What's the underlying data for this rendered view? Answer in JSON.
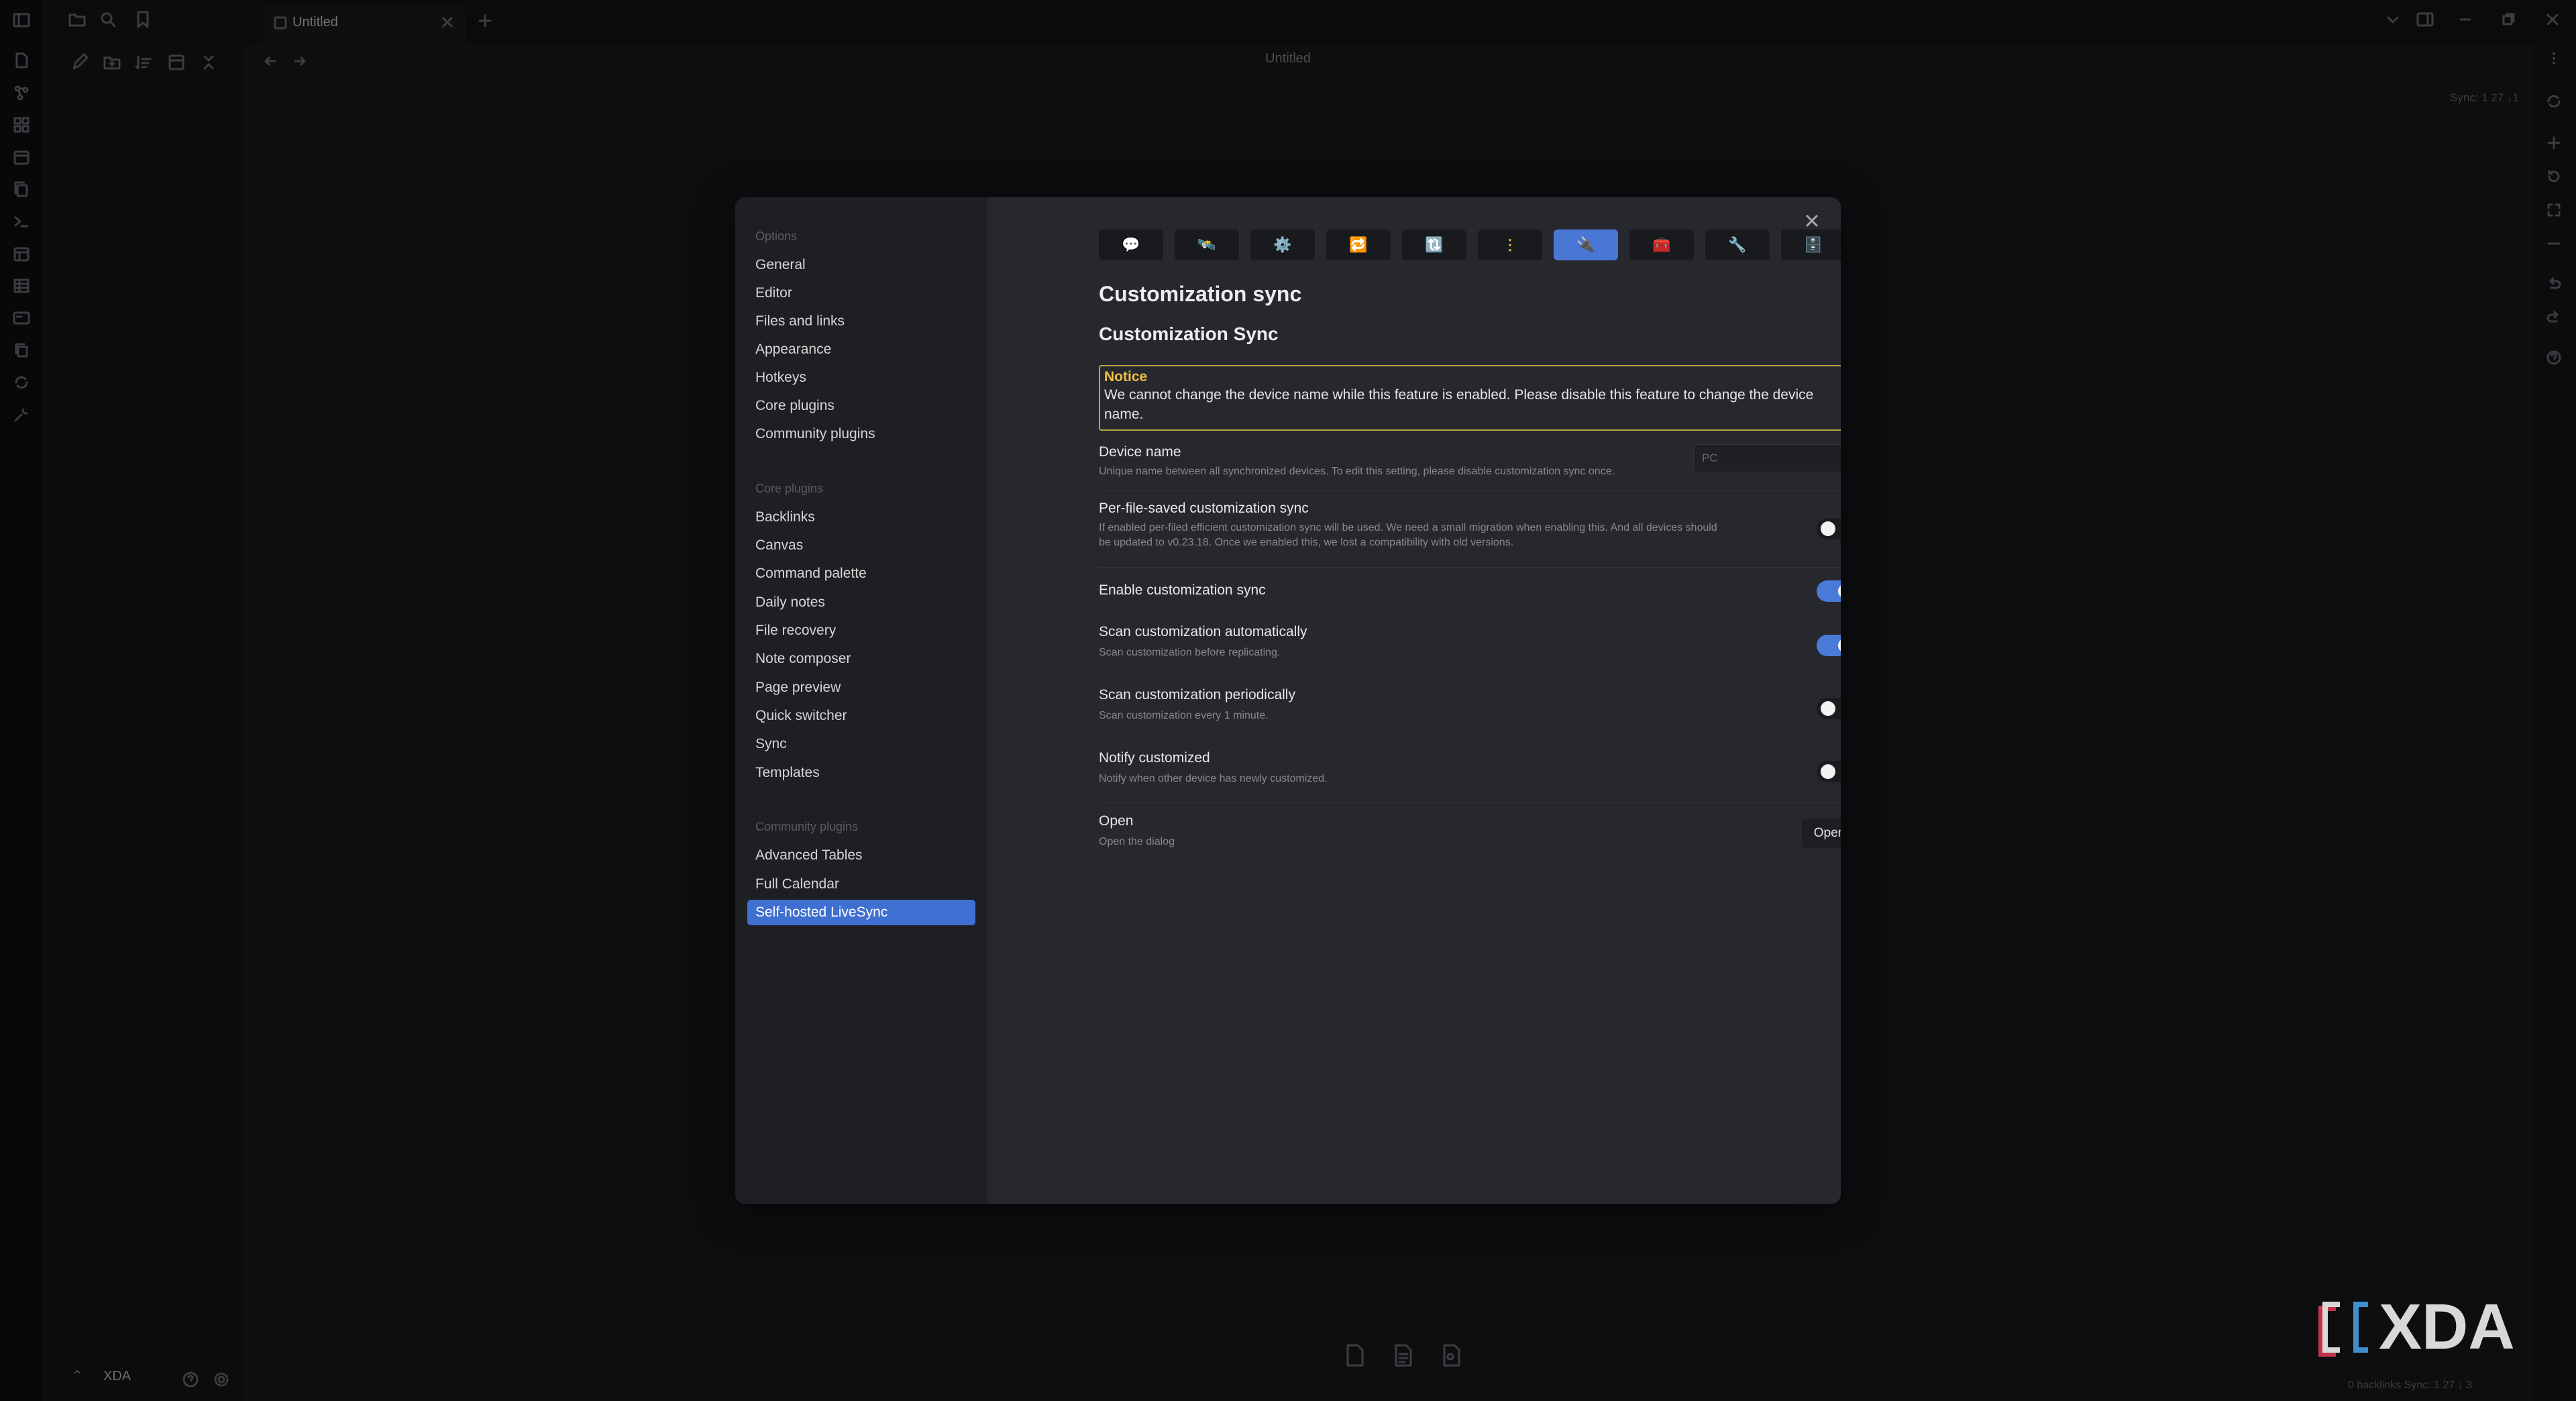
{
  "window": {
    "tab_title": "Untitled",
    "doc_title": "Untitled",
    "vault_name": "XDA",
    "sync_badge": "Sync: 1 27 ↓1",
    "status_bar": "0 backlinks   Sync: 1 27 ↓ 3"
  },
  "settings_nav": {
    "options_header": "Options",
    "options": [
      "General",
      "Editor",
      "Files and links",
      "Appearance",
      "Hotkeys",
      "Core plugins",
      "Community plugins"
    ],
    "core_header": "Core plugins",
    "core": [
      "Backlinks",
      "Canvas",
      "Command palette",
      "Daily notes",
      "File recovery",
      "Note composer",
      "Page preview",
      "Quick switcher",
      "Sync",
      "Templates"
    ],
    "community_header": "Community plugins",
    "community": [
      "Advanced Tables",
      "Full Calendar",
      "Self-hosted LiveSync"
    ],
    "active": "Self-hosted LiveSync"
  },
  "plugin_tabs": [
    {
      "icon": "💬",
      "name": "chat"
    },
    {
      "icon": "🛰️",
      "name": "satellite"
    },
    {
      "icon": "⚙️",
      "name": "gear"
    },
    {
      "icon": "🔁",
      "name": "sync"
    },
    {
      "icon": "🔃",
      "name": "refresh"
    },
    {
      "icon": "⋮",
      "name": "more"
    },
    {
      "icon": "🔌",
      "name": "plug",
      "active": true
    },
    {
      "icon": "🧰",
      "name": "toolbox"
    },
    {
      "icon": "🔧",
      "name": "wrench"
    },
    {
      "icon": "🗄️",
      "name": "database"
    }
  ],
  "content": {
    "title": "Customization sync",
    "subtitle": "Customization Sync",
    "notice_title": "Notice",
    "notice_body": "We cannot change the device name while this feature is enabled. Please disable this feature to change the device name.",
    "device_name": {
      "label": "Device name",
      "desc": "Unique name between all synchronized devices. To edit this setting, please disable customization sync once.",
      "value": "PC"
    },
    "per_file": {
      "label": "Per-file-saved customization sync",
      "desc1": "If enabled per-filed efficient customization sync will be used. We need a small migration when enabling this. And all devices should",
      "desc2": "be updated to v0.23.18. Once we enabled this, we lost a compatibility with old versions.",
      "on": false
    },
    "enable": {
      "label": "Enable customization sync",
      "on": true
    },
    "scan_auto": {
      "label": "Scan customization automatically",
      "desc": "Scan customization before replicating.",
      "on": true
    },
    "scan_periodic": {
      "label": "Scan customization periodically",
      "desc": "Scan customization every 1 minute.",
      "on": false
    },
    "notify": {
      "label": "Notify customized",
      "desc": "Notify when other device has newly customized.",
      "on": false
    },
    "open": {
      "label": "Open",
      "desc": "Open the dialog",
      "button": "Open"
    }
  },
  "watermark": "XDA",
  "colors": {
    "accent": "#4a7ad8",
    "notice_border": "#b9a24a",
    "notice_title": "#f0c040"
  }
}
